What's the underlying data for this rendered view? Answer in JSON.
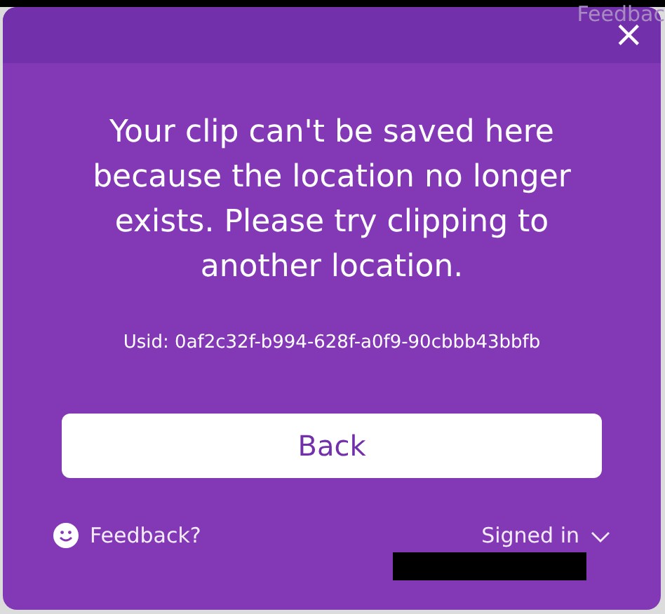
{
  "background_link": "Feedbac",
  "dialog": {
    "close_label": "×",
    "message": "Your clip can't be saved here because the location no longer exists. Please try clipping to another location.",
    "usid": "Usid: 0af2c32f-b994-628f-a0f9-90cbbb43bbfb",
    "button": "Back",
    "feedback": "Feedback?",
    "account": {
      "label": "Signed in",
      "expanded": false
    }
  }
}
